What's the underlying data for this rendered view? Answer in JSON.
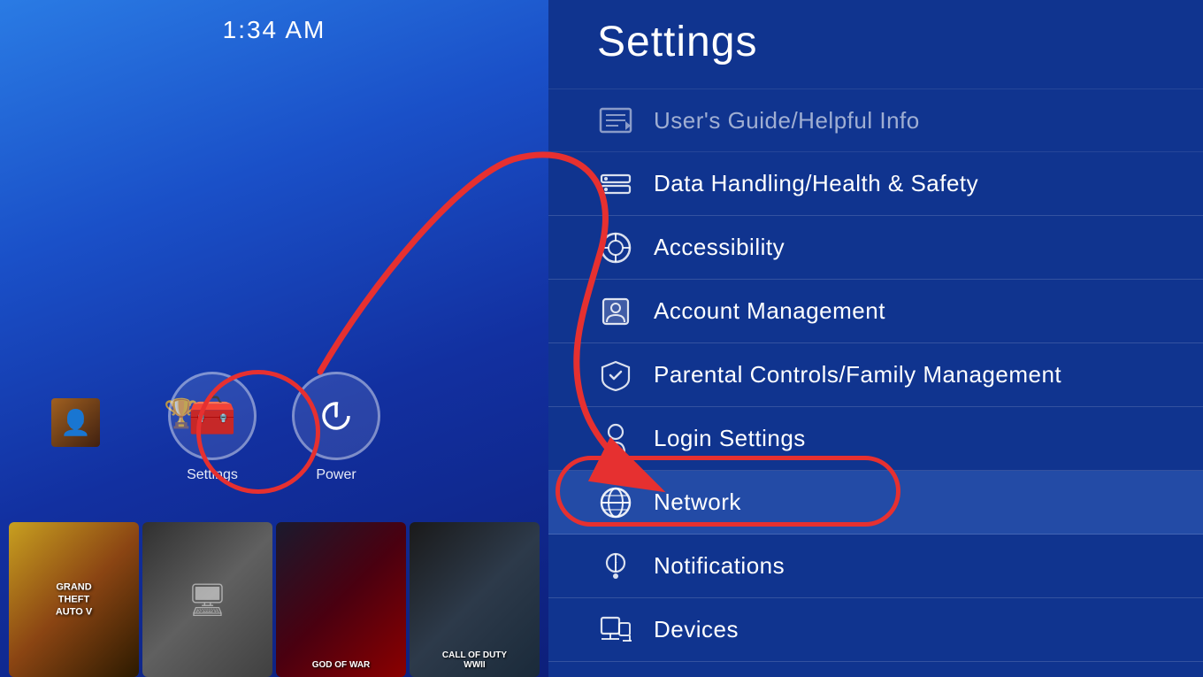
{
  "ui": {
    "time": "1:34 AM",
    "left_panel": {
      "icons": [
        {
          "id": "settings",
          "label": "Settings",
          "glyph": "🧰"
        },
        {
          "id": "power",
          "label": "Power",
          "glyph": "⏻"
        }
      ],
      "game_thumbnails": [
        {
          "id": "gta5",
          "label": "GRAND THEFT AUTO V"
        },
        {
          "id": "tv",
          "label": ""
        },
        {
          "id": "gow",
          "label": "GOD OF WAR"
        },
        {
          "id": "cod",
          "label": "CALL OF DUTY WWII"
        }
      ]
    },
    "right_panel": {
      "title": "Settings",
      "menu_items": [
        {
          "id": "users-guide",
          "label": "User's Guide/Helpful Info",
          "icon": "🏳️"
        },
        {
          "id": "data-handling",
          "label": "Data Handling/Health & Safety",
          "icon": "⊞"
        },
        {
          "id": "accessibility",
          "label": "Accessibility",
          "icon": "♿"
        },
        {
          "id": "account-management",
          "label": "Account Management",
          "icon": "👤"
        },
        {
          "id": "parental-controls",
          "label": "Parental Controls/Family Management",
          "icon": "🛡"
        },
        {
          "id": "login-settings",
          "label": "Login Settings",
          "icon": "🔒"
        },
        {
          "id": "network",
          "label": "Network",
          "icon": "🌐",
          "highlighted": true
        },
        {
          "id": "notifications",
          "label": "Notifications",
          "icon": "ℹ"
        },
        {
          "id": "devices",
          "label": "Devices",
          "icon": "🖱"
        }
      ]
    },
    "annotation": {
      "arrow_color": "#e63030",
      "circle_settings_label": "Settings circle",
      "circle_network_label": "Network highlight circle"
    }
  }
}
